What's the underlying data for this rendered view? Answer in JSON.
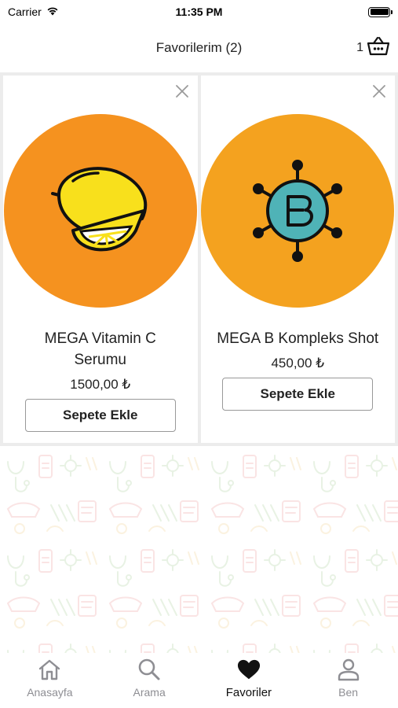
{
  "status_bar": {
    "carrier": "Carrier",
    "time": "11:35 PM"
  },
  "header": {
    "title": "Favorilerim (2)",
    "cart_count": "1",
    "cart_icon": "basket-icon"
  },
  "products": [
    {
      "name_line1": "MEGA Vitamin C",
      "name_line2": "Serumu",
      "price": "1500,00 ₺",
      "button_label": "Sepete Ekle",
      "image_icon": "lemon-icon",
      "image_bg": "#f5921f"
    },
    {
      "name_line1": "MEGA B Kompleks Shot",
      "name_line2": "",
      "price": "450,00 ₺",
      "button_label": "Sepete Ekle",
      "image_icon": "b-complex-molecule-icon",
      "image_bg": "#f4a21f"
    }
  ],
  "tab_bar": {
    "items": [
      {
        "label": "Anasayfa",
        "icon": "home-icon",
        "active": false
      },
      {
        "label": "Arama",
        "icon": "search-icon",
        "active": false
      },
      {
        "label": "Favoriler",
        "icon": "heart-icon",
        "active": true
      },
      {
        "label": "Ben",
        "icon": "person-icon",
        "active": false
      }
    ]
  },
  "colors": {
    "accent_orange": "#f5921f",
    "lemon_yellow": "#f8e01c",
    "molecule_teal": "#4fb3b7",
    "inactive_tab": "#8e8e93"
  }
}
